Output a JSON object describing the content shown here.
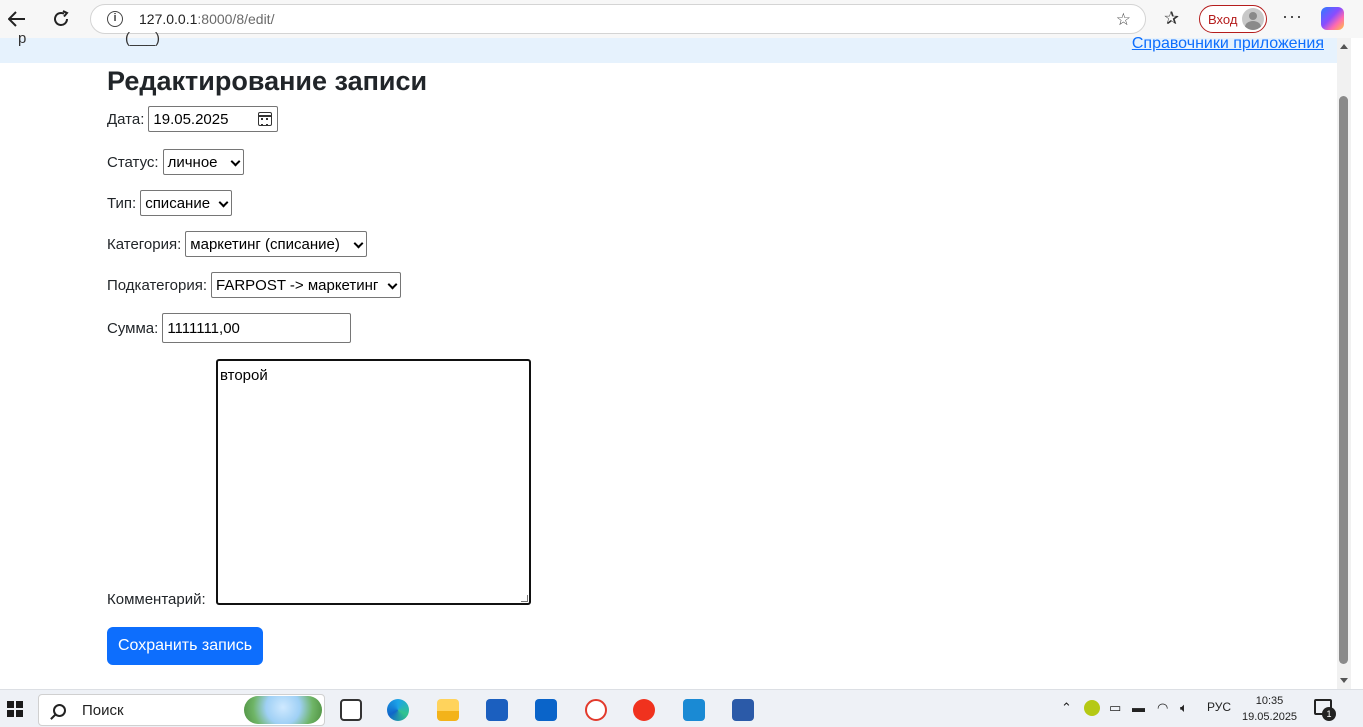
{
  "browser": {
    "url_host": "127.0.0.1",
    "url_path": ":8000/8/edit/",
    "login_label": "Вход",
    "more_label": "···"
  },
  "header": {
    "cut_text_left": "р",
    "cut_text_mid": "(___)",
    "nav_link": "Справочники приложения"
  },
  "page": {
    "title": "Редактирование записи",
    "fields": {
      "date_label": "Дата:",
      "date_value": "19.05.2025",
      "status_label": "Статус:",
      "status_value": "личное",
      "type_label": "Тип:",
      "type_value": "списание",
      "category_label": "Категория:",
      "category_value": "маркетинг (списание)",
      "subcategory_label": "Подкатегория:",
      "subcategory_value": "FARPOST -> маркетинг",
      "sum_label": "Сумма:",
      "sum_value": "1111111,00",
      "comment_label": "Комментарий:",
      "comment_value": "второй"
    },
    "save_button": "Сохранить запись"
  },
  "taskbar": {
    "search_label": "Поиск",
    "language": "РУС",
    "time": "10:35",
    "date": "19.05.2025",
    "notification_count": "1",
    "apps": [
      "task-view",
      "edge",
      "file-explorer",
      "microsoft-store",
      "outlook",
      "yandex-browser",
      "yandex",
      "vscode",
      "word"
    ]
  },
  "colors": {
    "accent": "#0d6efd",
    "header_bg": "#e6f2fd",
    "login_red": "#b51d1d"
  }
}
